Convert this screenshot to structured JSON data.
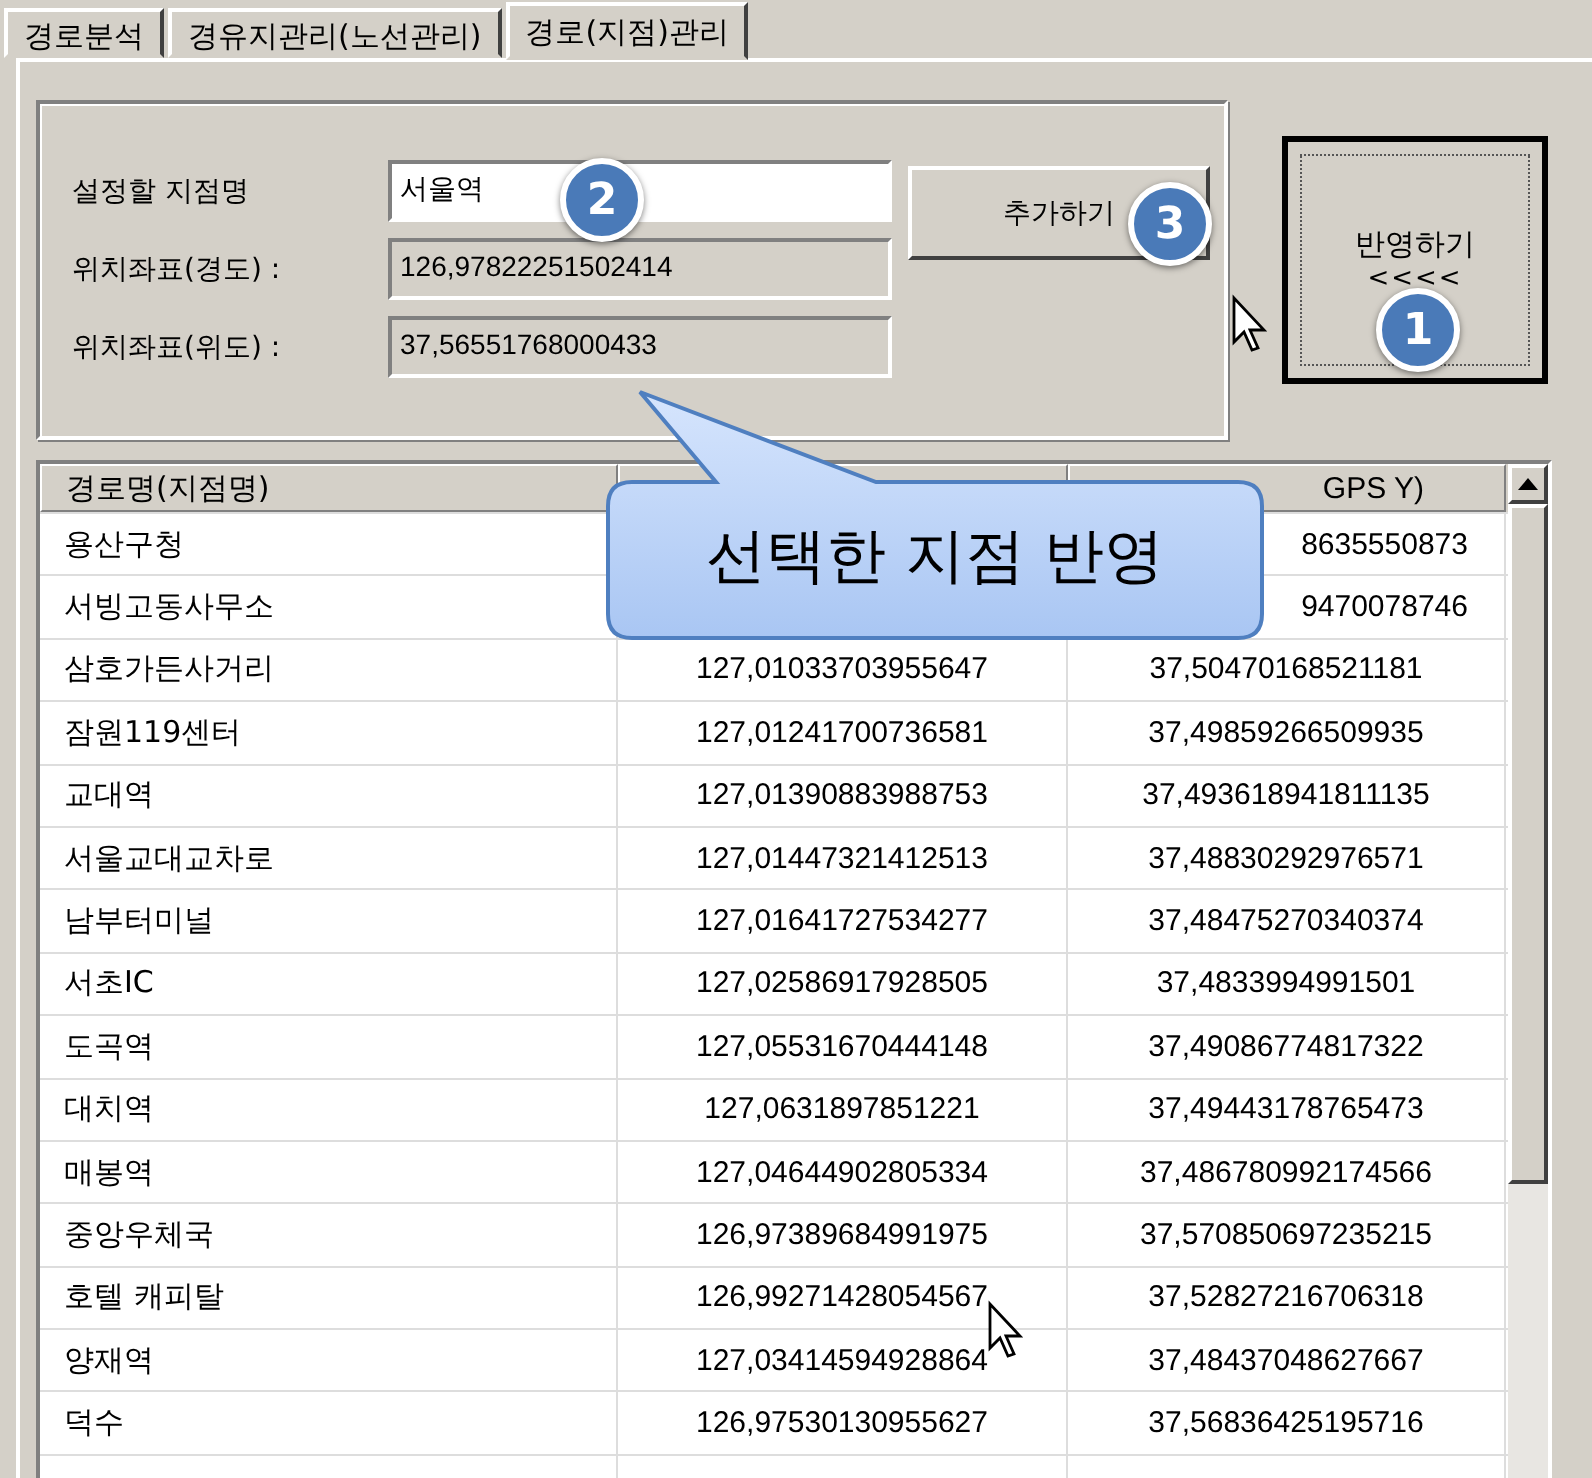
{
  "tabs": [
    {
      "label": "경로분석",
      "selected": false
    },
    {
      "label": "경유지관리(노선관리)",
      "selected": false
    },
    {
      "label": "경로(지점)관리",
      "selected": true
    }
  ],
  "form": {
    "name_label": "설정할 지점명",
    "name_value": "서울역",
    "lon_label": "위치좌표(경도) :",
    "lon_value": "126,97822251502414",
    "lat_label": "위치좌표(위도) :",
    "lat_value": "37,56551768000433",
    "add_button": "추가하기",
    "apply_button": "반영하기",
    "apply_arrows": "<<<<"
  },
  "badges": [
    {
      "label": "2",
      "kind": "name"
    },
    {
      "label": "3",
      "kind": "add"
    },
    {
      "label": "1",
      "kind": "apply"
    }
  ],
  "callout": {
    "text": "선택한 지점 반영"
  },
  "table": {
    "columns": [
      "경로명(지점명)",
      "",
      "GPS Y)"
    ],
    "rows": [
      {
        "cells": [
          "용산구청",
          "",
          "8635550873"
        ]
      },
      {
        "cells": [
          "서빙고동사무소",
          "",
          "9470078746"
        ]
      },
      {
        "cells": [
          "삼호가든사거리",
          "127,01033703955647",
          "37,50470168521181"
        ]
      },
      {
        "cells": [
          "잠원119센터",
          "127,01241700736581",
          "37,49859266509935"
        ]
      },
      {
        "cells": [
          "교대역",
          "127,01390883988753",
          "37,493618941811135"
        ]
      },
      {
        "cells": [
          "서울교대교차로",
          "127,01447321412513",
          "37,48830292976571"
        ]
      },
      {
        "cells": [
          "남부터미널",
          "127,01641727534277",
          "37,48475270340374"
        ]
      },
      {
        "cells": [
          "서초IC",
          "127,02586917928505",
          "37,4833994991501"
        ]
      },
      {
        "cells": [
          "도곡역",
          "127,05531670444148",
          "37,49086774817322"
        ]
      },
      {
        "cells": [
          "대치역",
          "127,0631897851221",
          "37,49443178765473"
        ]
      },
      {
        "cells": [
          "매봉역",
          "127,04644902805334",
          "37,486780992174566"
        ]
      },
      {
        "cells": [
          "중앙우체국",
          "126,97389684991975",
          "37,570850697235215"
        ]
      },
      {
        "cells": [
          "호텔 캐피탈",
          "126,99271428054567",
          "37,52827216706318"
        ]
      },
      {
        "cells": [
          "양재역",
          "127,03414594928864",
          "37,48437048627667"
        ]
      },
      {
        "cells": [
          "덕수",
          "126,97530130955627",
          "37,56836425195716"
        ]
      }
    ]
  }
}
